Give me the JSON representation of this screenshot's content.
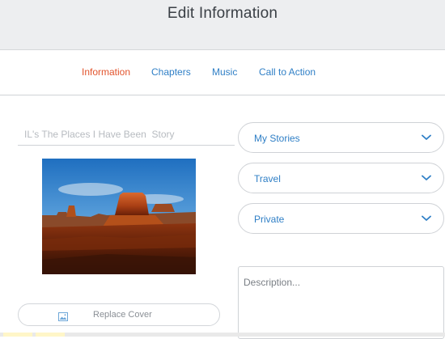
{
  "header": {
    "title": "Edit Information"
  },
  "tabs": [
    {
      "label": "Information",
      "active": true
    },
    {
      "label": "Chapters",
      "active": false
    },
    {
      "label": "Music",
      "active": false
    },
    {
      "label": "Call to Action",
      "active": false
    }
  ],
  "form": {
    "title_placeholder": "IL's The Places I Have Been  Story",
    "replace_cover_label": "Replace Cover",
    "replace_cover_icon": "image-icon",
    "selects": [
      {
        "value": "My Stories"
      },
      {
        "value": "Travel"
      },
      {
        "value": "Private"
      }
    ],
    "description_placeholder": "Description..."
  },
  "colors": {
    "accent_active": "#e2542d",
    "link_blue": "#2f7fc6",
    "header_bg": "#edeef0"
  }
}
